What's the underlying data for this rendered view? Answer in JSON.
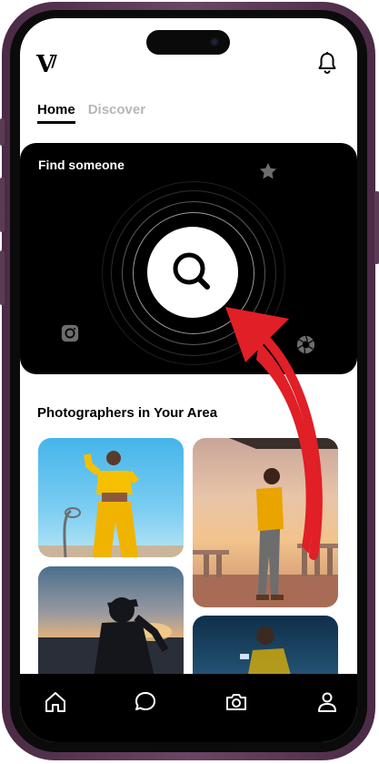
{
  "header": {
    "logo_text": "V"
  },
  "tabs": [
    {
      "label": "Home",
      "active": true
    },
    {
      "label": "Discover",
      "active": false
    }
  ],
  "hero": {
    "title": "Find someone"
  },
  "section": {
    "title": "Photographers in Your Area"
  },
  "icons": {
    "bell": "bell-icon",
    "search": "search-icon",
    "star": "star-icon",
    "instagram": "instagram-icon",
    "aperture": "aperture-icon",
    "home": "home-icon",
    "chat": "chat-icon",
    "camera": "camera-icon",
    "profile": "profile-icon"
  },
  "colors": {
    "accent_arrow": "#e01f26",
    "hero_bg": "#000000",
    "tab_inactive": "#b7b7b7"
  }
}
